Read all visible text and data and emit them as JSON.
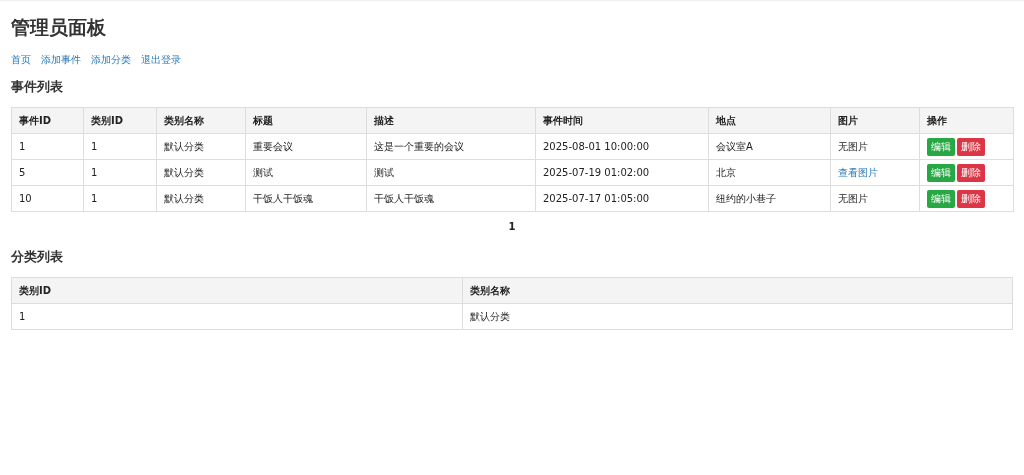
{
  "title": "管理员面板",
  "nav": [
    "首页",
    "添加事件",
    "添加分类",
    "退出登录"
  ],
  "events": {
    "heading": "事件列表",
    "columns": [
      "事件ID",
      "类别ID",
      "类别名称",
      "标题",
      "描述",
      "事件时间",
      "地点",
      "图片",
      "操作"
    ],
    "rows": [
      {
        "cells": [
          "1",
          "1",
          "默认分类",
          "重要会议",
          "这是一个重要的会议",
          "2025-08-01 10:00:00",
          "会议室A"
        ],
        "image": {
          "kind": "text",
          "text": "无图片"
        },
        "actions": [
          {
            "label": "编辑",
            "kind": "edit"
          },
          {
            "label": "删除",
            "kind": "delete"
          }
        ]
      },
      {
        "cells": [
          "5",
          "1",
          "默认分类",
          "测试",
          "测试",
          "2025-07-19 01:02:00",
          "北京"
        ],
        "image": {
          "kind": "link",
          "text": "查看图片"
        },
        "actions": [
          {
            "label": "编辑",
            "kind": "edit"
          },
          {
            "label": "删除",
            "kind": "delete"
          }
        ]
      },
      {
        "cells": [
          "10",
          "1",
          "默认分类",
          "干饭人干饭魂",
          "干饭人干饭魂",
          "2025-07-17 01:05:00",
          "纽约的小巷子"
        ],
        "image": {
          "kind": "text",
          "text": "无图片"
        },
        "actions": [
          {
            "label": "编辑",
            "kind": "edit"
          },
          {
            "label": "删除",
            "kind": "delete"
          }
        ]
      }
    ],
    "pages": [
      {
        "label": "1",
        "selected": true
      }
    ]
  },
  "categories": {
    "heading": "分类列表",
    "columns": [
      "类别ID",
      "类别名称"
    ],
    "rows": [
      [
        "1",
        "默认分类"
      ]
    ]
  }
}
